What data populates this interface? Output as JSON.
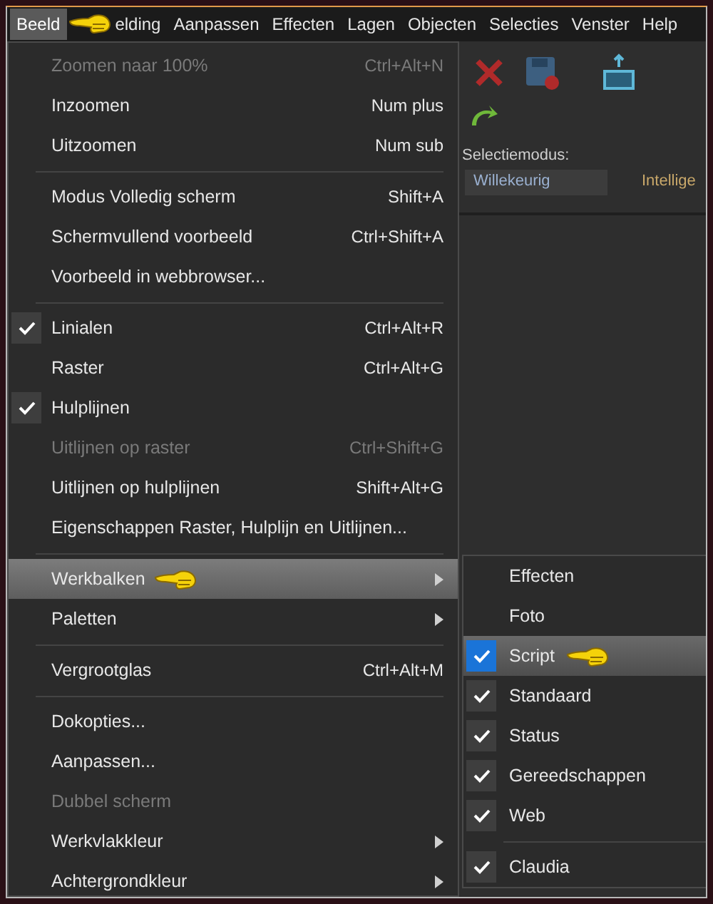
{
  "menubar": [
    {
      "label": "Beeld",
      "selected": true
    },
    {
      "label": "elding",
      "selected": false
    },
    {
      "label": "Aanpassen",
      "selected": false
    },
    {
      "label": "Effecten",
      "selected": false
    },
    {
      "label": "Lagen",
      "selected": false
    },
    {
      "label": "Objecten",
      "selected": false
    },
    {
      "label": "Selecties",
      "selected": false
    },
    {
      "label": "Venster",
      "selected": false
    },
    {
      "label": "Help",
      "selected": false
    }
  ],
  "toolbar": {
    "label": "Selectiemodus:",
    "field_value": "Willekeurig",
    "option": "Intellige"
  },
  "menu": [
    {
      "kind": "item",
      "label": "Zoomen naar 100%",
      "shortcut": "Ctrl+Alt+N",
      "disabled": true,
      "checked": false,
      "submenu": false,
      "selected": false
    },
    {
      "kind": "item",
      "label": "Inzoomen",
      "shortcut": "Num plus",
      "disabled": false,
      "checked": false,
      "submenu": false,
      "selected": false
    },
    {
      "kind": "item",
      "label": "Uitzoomen",
      "shortcut": "Num sub",
      "disabled": false,
      "checked": false,
      "submenu": false,
      "selected": false
    },
    {
      "kind": "separator"
    },
    {
      "kind": "item",
      "label": "Modus Volledig scherm",
      "shortcut": "Shift+A",
      "disabled": false,
      "checked": false,
      "submenu": false,
      "selected": false
    },
    {
      "kind": "item",
      "label": "Schermvullend voorbeeld",
      "shortcut": "Ctrl+Shift+A",
      "disabled": false,
      "checked": false,
      "submenu": false,
      "selected": false
    },
    {
      "kind": "item",
      "label": "Voorbeeld in webbrowser...",
      "disabled": false,
      "checked": false,
      "submenu": false,
      "selected": false
    },
    {
      "kind": "separator"
    },
    {
      "kind": "item",
      "label": "Linialen",
      "shortcut": "Ctrl+Alt+R",
      "disabled": false,
      "checked": true,
      "submenu": false,
      "selected": false
    },
    {
      "kind": "item",
      "label": "Raster",
      "shortcut": "Ctrl+Alt+G",
      "disabled": false,
      "checked": false,
      "submenu": false,
      "selected": false
    },
    {
      "kind": "item",
      "label": "Hulplijnen",
      "disabled": false,
      "checked": true,
      "submenu": false,
      "selected": false
    },
    {
      "kind": "item",
      "label": "Uitlijnen op raster",
      "shortcut": "Ctrl+Shift+G",
      "disabled": true,
      "checked": false,
      "submenu": false,
      "selected": false
    },
    {
      "kind": "item",
      "label": "Uitlijnen op hulplijnen",
      "shortcut": "Shift+Alt+G",
      "disabled": false,
      "checked": false,
      "submenu": false,
      "selected": false
    },
    {
      "kind": "item",
      "label": "Eigenschappen Raster, Hulplijn en Uitlijnen...",
      "disabled": false,
      "checked": false,
      "submenu": false,
      "selected": false
    },
    {
      "kind": "separator"
    },
    {
      "kind": "item",
      "label": "Werkbalken",
      "disabled": false,
      "checked": false,
      "submenu": true,
      "selected": true
    },
    {
      "kind": "item",
      "label": "Paletten",
      "disabled": false,
      "checked": false,
      "submenu": true,
      "selected": false
    },
    {
      "kind": "separator"
    },
    {
      "kind": "item",
      "label": "Vergrootglas",
      "shortcut": "Ctrl+Alt+M",
      "disabled": false,
      "checked": false,
      "submenu": false,
      "selected": false
    },
    {
      "kind": "separator"
    },
    {
      "kind": "item",
      "label": "Dokopties...",
      "disabled": false,
      "checked": false,
      "submenu": false,
      "selected": false
    },
    {
      "kind": "item",
      "label": "Aanpassen...",
      "disabled": false,
      "checked": false,
      "submenu": false,
      "selected": false
    },
    {
      "kind": "item",
      "label": "Dubbel scherm",
      "disabled": true,
      "checked": false,
      "submenu": false,
      "selected": false
    },
    {
      "kind": "item",
      "label": "Werkvlakkleur",
      "disabled": false,
      "checked": false,
      "submenu": true,
      "selected": false
    },
    {
      "kind": "item",
      "label": "Achtergrondkleur",
      "disabled": false,
      "checked": false,
      "submenu": true,
      "selected": false
    }
  ],
  "submenu": [
    {
      "kind": "item",
      "label": "Effecten",
      "checked": false,
      "selected": false
    },
    {
      "kind": "item",
      "label": "Foto",
      "checked": false,
      "selected": false
    },
    {
      "kind": "item",
      "label": "Script",
      "checked": true,
      "selected": true
    },
    {
      "kind": "item",
      "label": "Standaard",
      "checked": true,
      "selected": false
    },
    {
      "kind": "item",
      "label": "Status",
      "checked": true,
      "selected": false
    },
    {
      "kind": "item",
      "label": "Gereedschappen",
      "checked": true,
      "selected": false
    },
    {
      "kind": "item",
      "label": "Web",
      "checked": true,
      "selected": false
    },
    {
      "kind": "separator"
    },
    {
      "kind": "item",
      "label": "Claudia",
      "checked": true,
      "selected": false
    }
  ]
}
